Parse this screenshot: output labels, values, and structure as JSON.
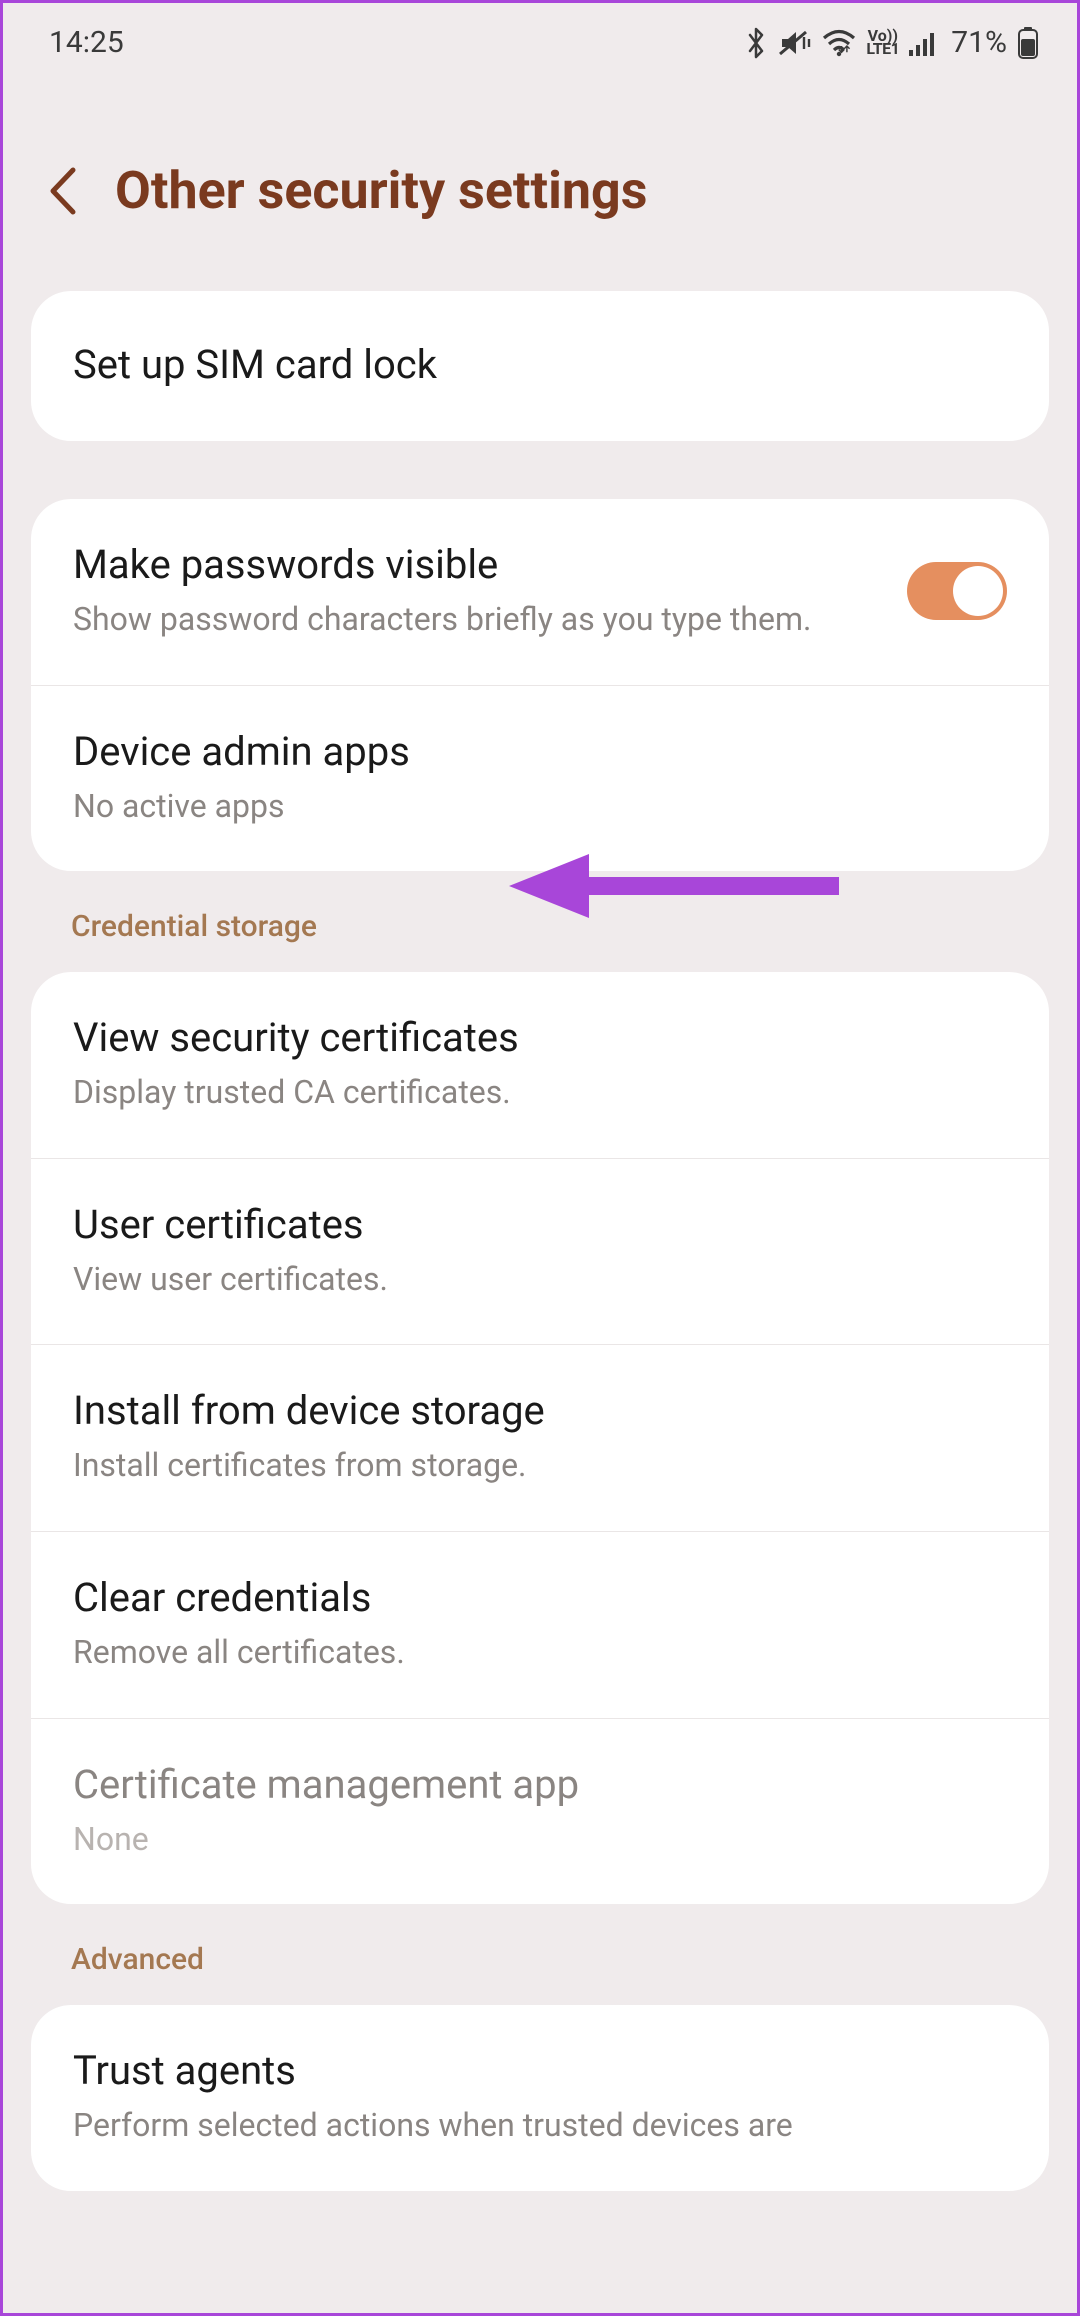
{
  "status_bar": {
    "time": "14:25",
    "battery_percent": "71%"
  },
  "header": {
    "title": "Other security settings"
  },
  "groups": [
    {
      "items": [
        {
          "title": "Set up SIM card lock"
        }
      ]
    },
    {
      "items": [
        {
          "title": "Make passwords visible",
          "subtitle": "Show password characters briefly as you type them.",
          "toggle": true,
          "toggle_on": true
        },
        {
          "title": "Device admin apps",
          "subtitle": "No active apps"
        }
      ]
    },
    {
      "header": "Credential storage",
      "items": [
        {
          "title": "View security certificates",
          "subtitle": "Display trusted CA certificates."
        },
        {
          "title": "User certificates",
          "subtitle": "View user certificates."
        },
        {
          "title": "Install from device storage",
          "subtitle": "Install certificates from storage."
        },
        {
          "title": "Clear credentials",
          "subtitle": "Remove all certificates."
        },
        {
          "title": "Certificate management app",
          "subtitle": "None",
          "disabled": true
        }
      ]
    },
    {
      "header": "Advanced",
      "items": [
        {
          "title": "Trust agents",
          "subtitle": "Perform selected actions when trusted devices are"
        }
      ]
    }
  ],
  "colors": {
    "accent": "#7a3a1f",
    "toggle_on": "#e58f5f",
    "annotation": "#a846d9"
  }
}
